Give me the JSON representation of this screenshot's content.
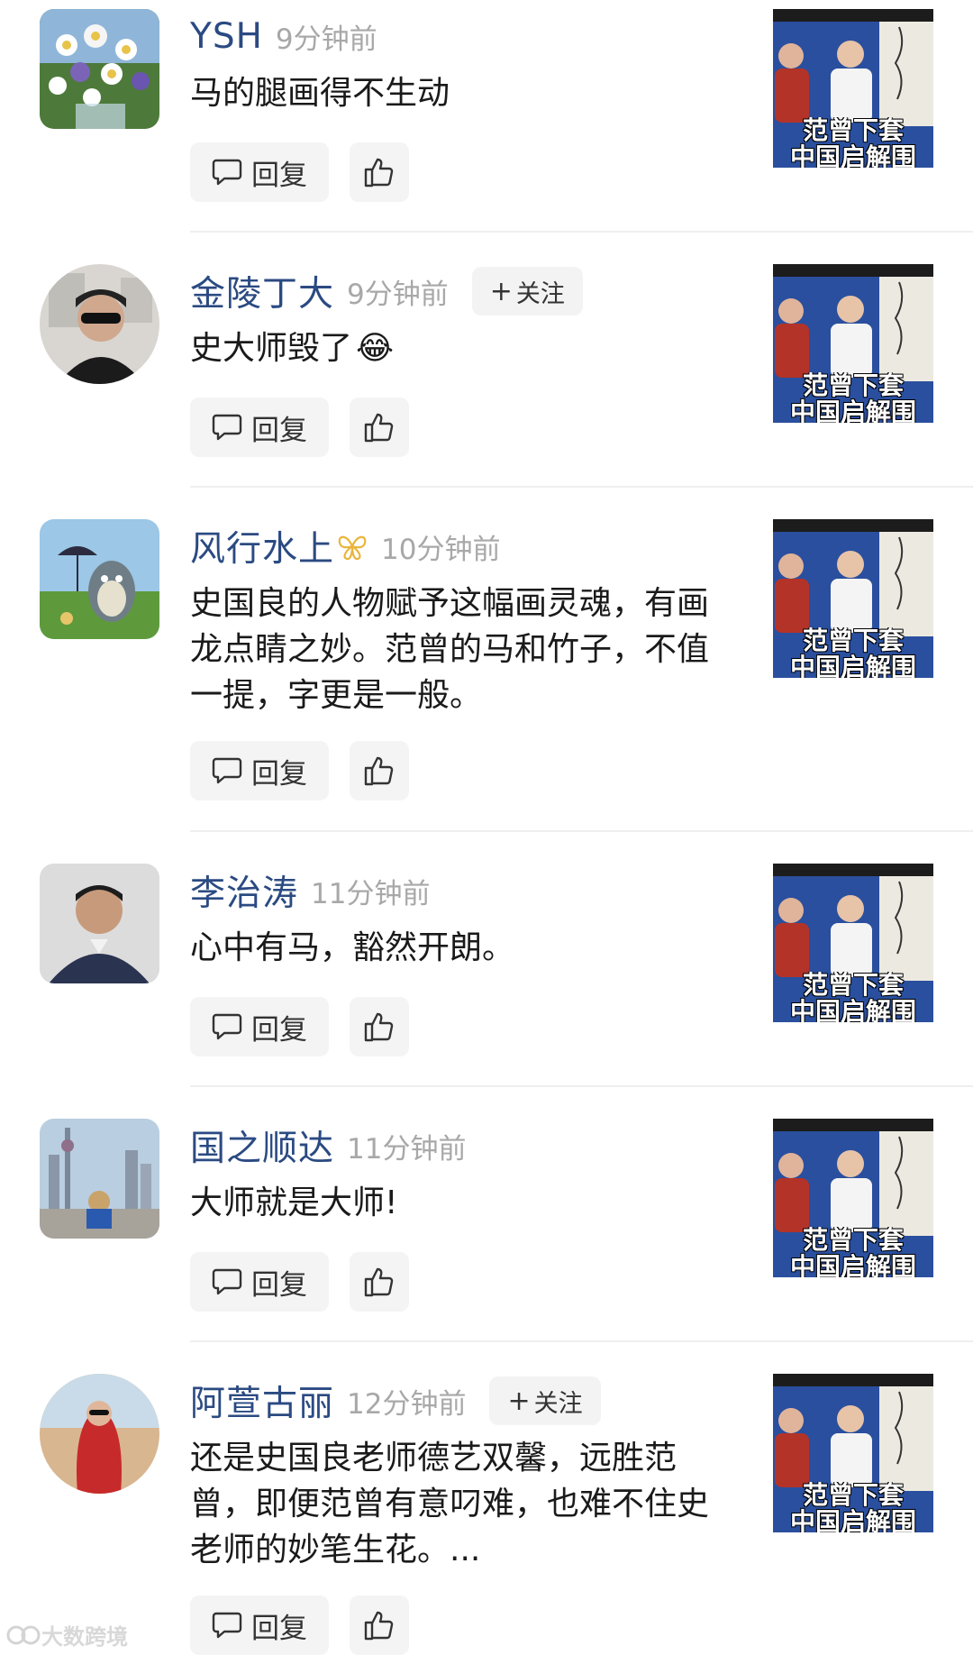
{
  "thumbnail_caption": "范曾下套\n中国启解围",
  "reply_label": "回复",
  "follow_label": "关注",
  "follow_plus": "+",
  "watermark": "大数跨境",
  "comments": [
    {
      "username": "YSH",
      "time": "9分钟前",
      "text": "马的腿画得不生动"
    },
    {
      "username": "金陵丁大",
      "time": "9分钟前",
      "text": "史大师毁了",
      "emoji": "😂",
      "follow": true
    },
    {
      "username": "风行水上",
      "time": "10分钟前",
      "text": "史国良的人物赋予这幅画灵魂，有画龙点睛之妙。范曾的马和竹子，不值一提，字更是一般。",
      "badge": "butterfly-icon"
    },
    {
      "username": "李治涛",
      "time": "11分钟前",
      "text": "心中有马，豁然开朗。"
    },
    {
      "username": "国之顺达",
      "time": "11分钟前",
      "text": "大师就是大师!"
    },
    {
      "username": "阿萱古丽",
      "time": "12分钟前",
      "text": "还是史国良老师德艺双馨，远胜范曾，即便范曾有意叼难，也难不住史老师的妙笔生花。...",
      "follow": true
    }
  ]
}
